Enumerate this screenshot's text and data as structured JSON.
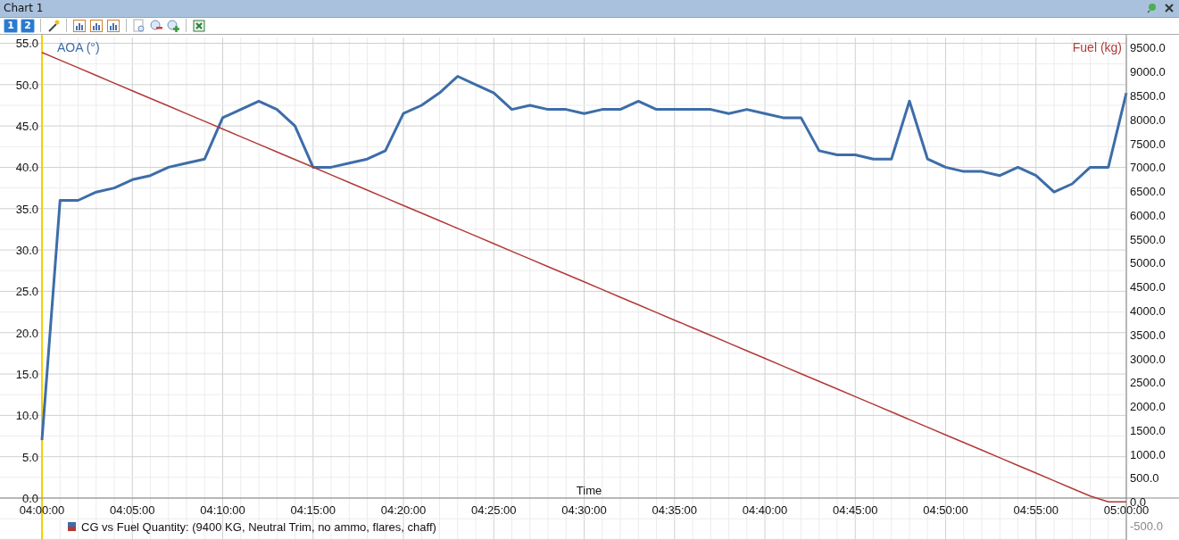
{
  "window": {
    "title": "Chart 1"
  },
  "toolbar": {
    "buttons": [
      {
        "label": "1"
      },
      {
        "label": "2"
      }
    ]
  },
  "chart": {
    "legend": [
      {
        "label": "CG vs Fuel Quantity: (9400 KG, Neutral Trim, no ammo, flares, chaff)",
        "color": "#b03a37"
      }
    ],
    "chart_data": {
      "type": "line",
      "xlabel": "Time",
      "categories": [
        "04:00:00",
        null,
        null,
        null,
        null,
        "04:05:00",
        null,
        null,
        null,
        null,
        "04:10:00",
        null,
        null,
        null,
        null,
        "04:15:00",
        null,
        null,
        null,
        null,
        "04:20:00",
        null,
        null,
        null,
        null,
        "04:25:00",
        null,
        null,
        null,
        null,
        "04:30:00",
        null,
        null,
        null,
        null,
        "04:35:00",
        null,
        null,
        null,
        null,
        "04:40:00",
        null,
        null,
        null,
        null,
        "04:45:00",
        null,
        null,
        null,
        null,
        "04:50:00",
        null,
        null,
        null,
        null,
        "04:55:00",
        null,
        null,
        null,
        null,
        "05:00:00"
      ],
      "series": [
        {
          "name": "AOA (°)",
          "color": "#3d6da8",
          "values": [
            7,
            36,
            36,
            37,
            37.5,
            38.5,
            39,
            40,
            40.5,
            41,
            46,
            47,
            48,
            47,
            45,
            40,
            40,
            40.5,
            41,
            42,
            46.5,
            47.5,
            49,
            51,
            50,
            49,
            47,
            47.5,
            47,
            47,
            46.5,
            47,
            47,
            48,
            47,
            47,
            47,
            47,
            46.5,
            47,
            46.5,
            46,
            46,
            42,
            41.5,
            41.5,
            41,
            41,
            48,
            41,
            40,
            39.5,
            39.5,
            39,
            40,
            39,
            37,
            38,
            40,
            40,
            49
          ]
        }
      ],
      "ylim": [
        0,
        55.7
      ],
      "grid": true,
      "yticks": [
        {
          "value": 0,
          "label": "0.0"
        },
        {
          "value": 5,
          "label": "5.0"
        },
        {
          "value": 10,
          "label": "10.0"
        },
        {
          "value": 15,
          "label": "15.0"
        },
        {
          "value": 20,
          "label": "20.0"
        },
        {
          "value": 25,
          "label": "25.0"
        },
        {
          "value": 30,
          "label": "30.0"
        },
        {
          "value": 35,
          "label": "35.0"
        },
        {
          "value": 40,
          "label": "40.0"
        },
        {
          "value": 45,
          "label": "45.0"
        },
        {
          "value": 50,
          "label": "50.0"
        },
        {
          "value": 55,
          "label": "55.0"
        }
      ]
    },
    "fuel_axis": {
      "chart_data": {
        "type": "line",
        "categories": [
          null,
          null,
          null,
          null,
          null,
          null,
          null,
          null,
          null,
          null,
          null,
          null,
          null,
          null,
          null,
          null,
          null,
          null,
          null,
          null,
          null,
          null,
          null,
          null,
          null,
          null,
          null,
          null,
          null,
          null,
          null,
          null,
          null,
          null,
          null,
          null,
          null,
          null,
          null,
          null,
          null,
          null,
          null,
          null,
          null,
          null,
          null,
          null,
          null,
          null,
          null,
          null,
          null,
          null,
          null,
          null,
          null,
          null,
          null,
          null,
          null
        ],
        "series": [
          {
            "name": "Fuel (kg)",
            "color": "#b03a37",
            "values": [
              9400,
              9240,
              9080,
              8920,
              8760,
              8600,
              8440,
              8280,
              8120,
              7960,
              7800,
              7640,
              7480,
              7320,
              7160,
              7000,
              6840,
              6680,
              6520,
              6360,
              6200,
              6040,
              5880,
              5720,
              5560,
              5400,
              5240,
              5080,
              4920,
              4760,
              4600,
              4440,
              4280,
              4120,
              3960,
              3800,
              3640,
              3480,
              3320,
              3160,
              3000,
              2840,
              2680,
              2520,
              2360,
              2200,
              2040,
              1880,
              1720,
              1560,
              1400,
              1240,
              1080,
              920,
              760,
              600,
              440,
              280,
              120,
              0,
              0
            ]
          }
        ],
        "ylim": [
          -800,
          9770
        ],
        "yticks": [
          {
            "value": -500,
            "label": "-500.0"
          },
          {
            "value": 0,
            "label": "0.0"
          },
          {
            "value": 500,
            "label": "500.0"
          },
          {
            "value": 1000,
            "label": "1000.0"
          },
          {
            "value": 1500,
            "label": "1500.0"
          },
          {
            "value": 2000,
            "label": "2000.0"
          },
          {
            "value": 2500,
            "label": "2500.0"
          },
          {
            "value": 3000,
            "label": "3000.0"
          },
          {
            "value": 3500,
            "label": "3500.0"
          },
          {
            "value": 4000,
            "label": "4000.0"
          },
          {
            "value": 4500,
            "label": "4500.0"
          },
          {
            "value": 5000,
            "label": "5000.0"
          },
          {
            "value": 5500,
            "label": "5500.0"
          },
          {
            "value": 6000,
            "label": "6000.0"
          },
          {
            "value": 6500,
            "label": "6500.0"
          },
          {
            "value": 7000,
            "label": "7000.0"
          },
          {
            "value": 7500,
            "label": "7500.0"
          },
          {
            "value": 8000,
            "label": "8000.0"
          },
          {
            "value": 8500,
            "label": "8500.0"
          },
          {
            "value": 9000,
            "label": "9000.0"
          },
          {
            "value": 9500,
            "label": "9500.0"
          }
        ]
      }
    }
  }
}
